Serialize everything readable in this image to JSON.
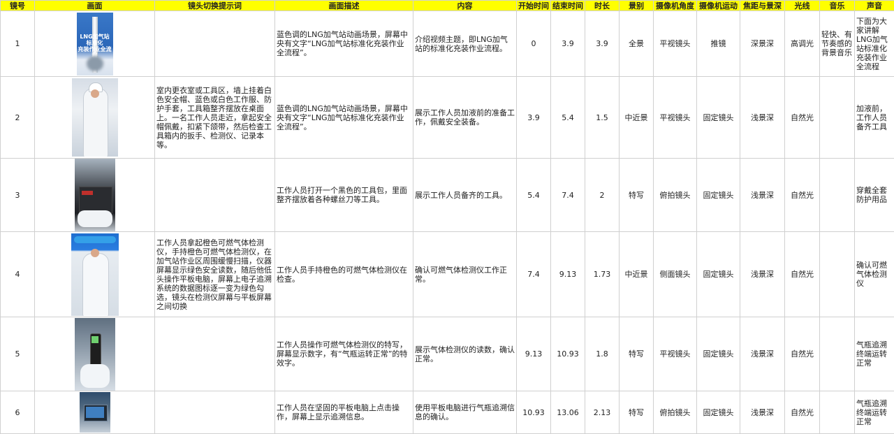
{
  "headers": [
    "镜号",
    "画面",
    "镜头切换提示词",
    "画面描述",
    "内容",
    "开始时间",
    "结束时间",
    "时长",
    "景别",
    "摄像机角度",
    "摄像机运动",
    "焦距与景深",
    "光线",
    "音乐",
    "声音"
  ],
  "thumb_text": "LNG加气站标准化\n充装作业全流程",
  "rows": [
    {
      "no": "1",
      "prompt": "",
      "desc": "蓝色调的LNG加气站动画场景，屏幕中央有文字“LNG加气站标准化充装作业全流程”。",
      "content": "介绍视频主题，即LNG加气站的标准化充装作业流程。",
      "start": "0",
      "end": "3.9",
      "dur": "3.9",
      "shot": "全景",
      "angle": "平视镜头",
      "move": "推镜",
      "focus": "深景深",
      "light": "高调光",
      "music": "轻快、有节奏感的背景音乐",
      "sound": "下面为大家讲解LNG加气站标准化充装作业全流程"
    },
    {
      "no": "2",
      "prompt": "室内更衣室或工具区，墙上挂着白色安全帽、蓝色或白色工作服、防护手套，工具箱整齐摆放在桌面上。一名工作人员走近，拿起安全帽佩戴，扣紧下颌带，然后检查工具箱内的扳手、检测仪、记录本等。",
      "desc": "蓝色调的LNG加气站动画场景，屏幕中央有文字“LNG加气站标准化充装作业全流程”。",
      "content": "展示工作人员加液前的准备工作，佩戴安全装备。",
      "start": "3.9",
      "end": "5.4",
      "dur": "1.5",
      "shot": "中近景",
      "angle": "平视镜头",
      "move": "固定镜头",
      "focus": "浅景深",
      "light": "自然光",
      "music": "",
      "sound": "加液前，工作人员备齐工具"
    },
    {
      "no": "3",
      "prompt": "",
      "desc": "工作人员打开一个黑色的工具包，里面整齐摆放着各种螺丝刀等工具。",
      "content": "展示工作人员备齐的工具。",
      "start": "5.4",
      "end": "7.4",
      "dur": "2",
      "shot": "特写",
      "angle": "俯拍镜头",
      "move": "固定镜头",
      "focus": "浅景深",
      "light": "自然光",
      "music": "",
      "sound": "穿戴全套防护用品"
    },
    {
      "no": "4",
      "prompt": "工作人员拿起橙色可燃气体检测仪，手持橙色可燃气体检测仪，在加气站作业区周围缓慢扫描，仪器屏幕显示绿色安全读数，随后他低头操作平板电脑，屏幕上电子追溯系统的数据图标逐一变为绿色勾选，镜头在检测仪屏幕与平板屏幕之间切换",
      "desc": "工作人员手持橙色的可燃气体检测仪在检查。",
      "content": "确认可燃气体检测仪工作正常。",
      "start": "7.4",
      "end": "9.13",
      "dur": "1.73",
      "shot": "中近景",
      "angle": "侧面镜头",
      "move": "固定镜头",
      "focus": "浅景深",
      "light": "自然光",
      "music": "",
      "sound": "确认可燃气体检测仪"
    },
    {
      "no": "5",
      "prompt": "",
      "desc": "工作人员操作可燃气体检测仪的特写，屏幕显示数字，有“气瓶运转正常”的特效字。",
      "content": "展示气体检测仪的读数，确认正常。",
      "start": "9.13",
      "end": "10.93",
      "dur": "1.8",
      "shot": "特写",
      "angle": "平视镜头",
      "move": "固定镜头",
      "focus": "浅景深",
      "light": "自然光",
      "music": "",
      "sound": "气瓶追溯终端运转正常"
    },
    {
      "no": "6",
      "prompt": "",
      "desc": "工作人员在坚固的平板电脑上点击操作，屏幕上显示追溯信息。",
      "content": "使用平板电脑进行气瓶追溯信息的确认。",
      "start": "10.93",
      "end": "13.06",
      "dur": "2.13",
      "shot": "特写",
      "angle": "俯拍镜头",
      "move": "固定镜头",
      "focus": "浅景深",
      "light": "自然光",
      "music": "",
      "sound": "气瓶追溯终端运转正常"
    }
  ]
}
